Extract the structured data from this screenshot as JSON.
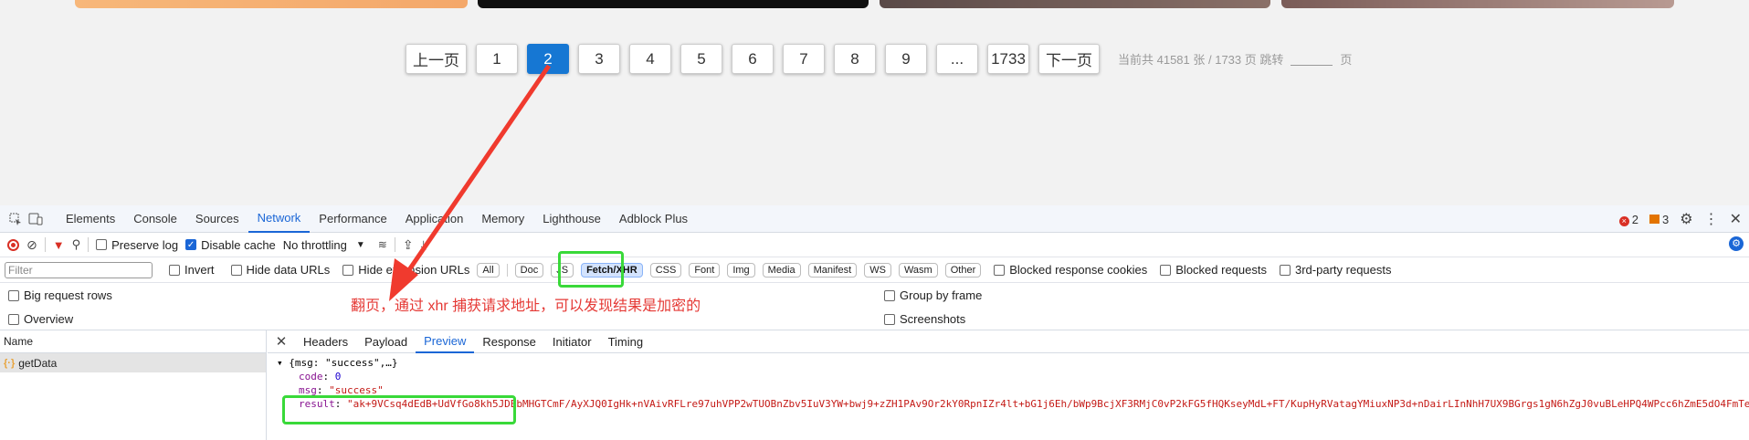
{
  "pagination": {
    "prev_label": "上一页",
    "pages": [
      "1",
      "2",
      "3",
      "4",
      "5",
      "6",
      "7",
      "8",
      "9",
      "...",
      "1733"
    ],
    "active_page": "2",
    "next_label": "下一页",
    "info_prefix": "当前共 41581 张 / 1733 页 跳转",
    "info_suffix": "页"
  },
  "devtools": {
    "tabs": [
      "Elements",
      "Console",
      "Sources",
      "Network",
      "Performance",
      "Application",
      "Memory",
      "Lighthouse",
      "Adblock Plus"
    ],
    "active_tab": "Network",
    "error_count": "2",
    "warning_count": "3",
    "toolbar": {
      "preserve_log": "Preserve log",
      "disable_cache": "Disable cache",
      "throttling": "No throttling"
    },
    "filter": {
      "placeholder": "Filter",
      "invert": "Invert",
      "hide_data_urls": "Hide data URLs",
      "hide_extension_urls": "Hide extension URLs",
      "chips": [
        "All",
        "Doc",
        "JS",
        "Fetch/XHR",
        "CSS",
        "Font",
        "Img",
        "Media",
        "Manifest",
        "WS",
        "Wasm",
        "Other"
      ],
      "selected_chip": "Fetch/XHR",
      "blocked_response_cookies": "Blocked response cookies",
      "blocked_requests": "Blocked requests",
      "third_party": "3rd-party requests"
    },
    "options": {
      "big_request_rows": "Big request rows",
      "overview": "Overview",
      "group_by_frame": "Group by frame",
      "screenshots": "Screenshots"
    },
    "annotation": "翻页，通过 xhr 捕获请求地址，可以发现结果是加密的",
    "name_column": {
      "header": "Name",
      "rows": [
        "getData"
      ]
    },
    "detail_tabs": [
      "Headers",
      "Payload",
      "Preview",
      "Response",
      "Initiator",
      "Timing"
    ],
    "active_detail_tab": "Preview",
    "preview": {
      "summary": "{msg: \"success\",…}",
      "code_key": "code",
      "code_value": "0",
      "msg_key": "msg",
      "msg_value": "\"success\"",
      "result_key": "result",
      "result_value": "\"ak+9VCsq4dEdB+UdVfGo8kh5JDEbMHGTCmF/AyXJQ0IgHk+nVAivRFLre97uhVPP2wTUOBnZbv5IuV3YW+bwj9+zZH1PAv9Or2kY0RpnIZr4lt+bG1j6Eh/bWp9BcjXF3RMjC0vP2kFG5fHQKseyMdL+FT/KupHyRVatagYMiuxNP3d+nDairLInNhH7UX9BGrgs1gN6hZgJ0vuBLeHPQ4WPcc6hZmE5dO4FmTe"
    },
    "colors": {
      "accent": "#1a66d6",
      "active_page_bg": "#1677d3",
      "highlight": "#39d939",
      "annotation": "#e53935"
    }
  }
}
